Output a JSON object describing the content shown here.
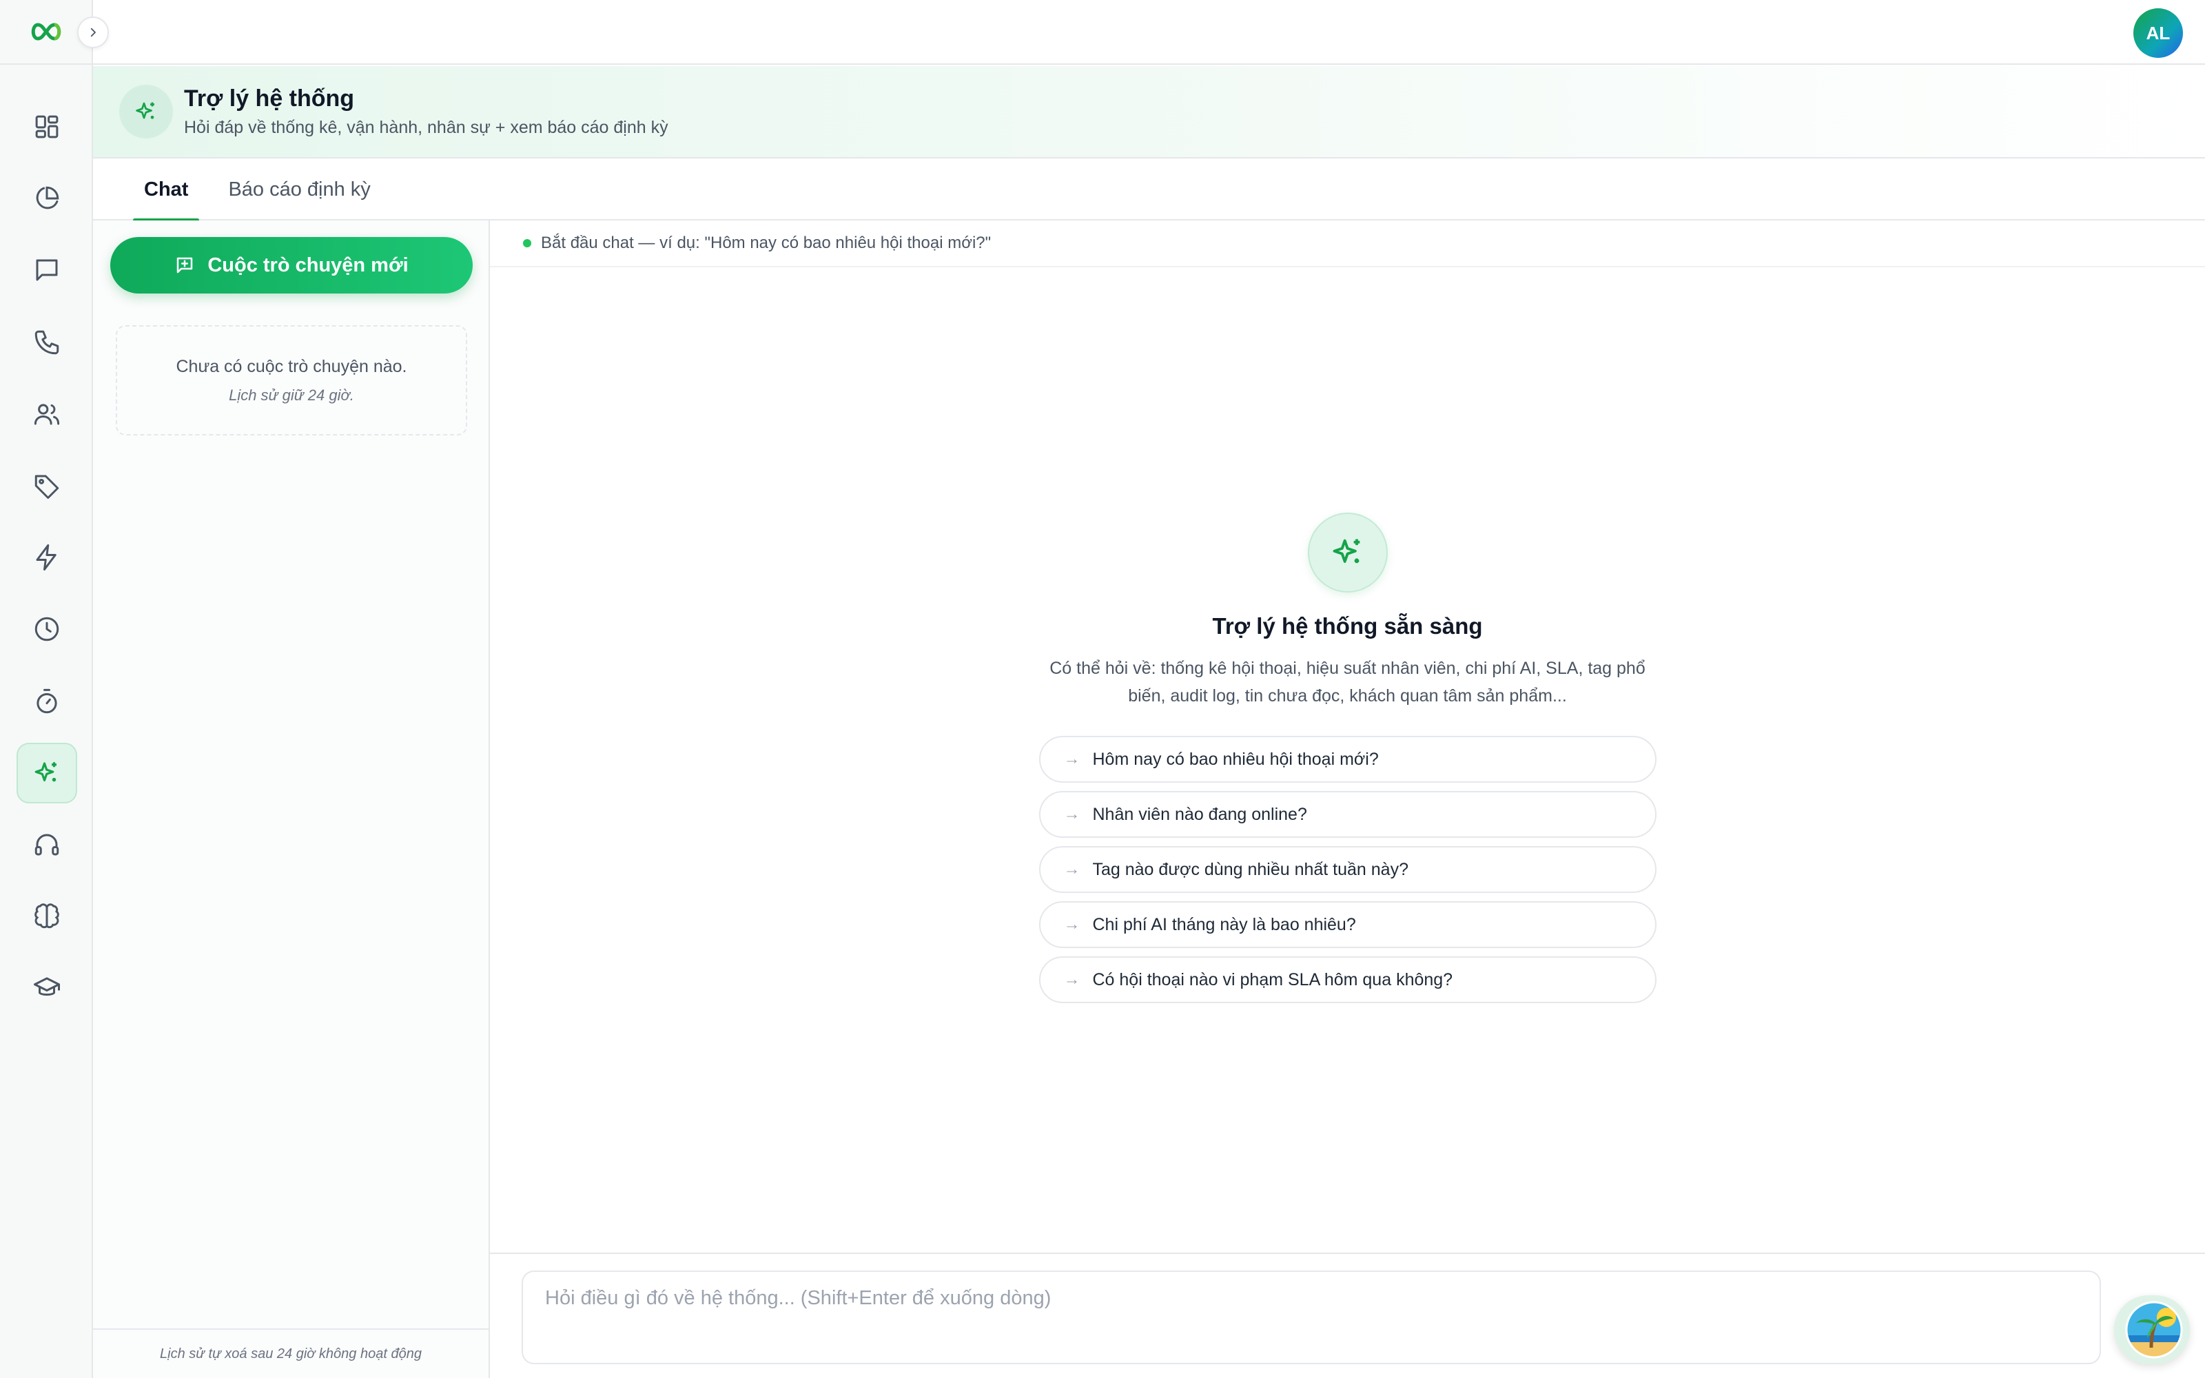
{
  "user": {
    "initials": "AL"
  },
  "header": {
    "title": "Trợ lý hệ thống",
    "subtitle": "Hỏi đáp về thống kê, vận hành, nhân sự + xem báo cáo định kỳ"
  },
  "tabs": [
    {
      "label": "Chat",
      "active": true
    },
    {
      "label": "Báo cáo định kỳ",
      "active": false
    }
  ],
  "sidebar": {
    "new_chat_label": "Cuộc trò chuyện mới",
    "empty_title": "Chưa có cuộc trò chuyện nào.",
    "empty_note": "Lịch sử giữ 24 giờ.",
    "footer": "Lịch sử tự xoá sau 24 giờ không hoạt động"
  },
  "chat": {
    "status": "Bắt đầu chat — ví dụ: \"Hôm nay có bao nhiêu hội thoại mới?\"",
    "welcome_title": "Trợ lý hệ thống sẵn sàng",
    "welcome_desc": "Có thể hỏi về: thống kê hội thoại, hiệu suất nhân viên, chi phí AI, SLA, tag phổ biến, audit log, tin chưa đọc, khách quan tâm sản phẩm...",
    "suggestions": [
      "Hôm nay có bao nhiêu hội thoại mới?",
      "Nhân viên nào đang online?",
      "Tag nào được dùng nhiều nhất tuần này?",
      "Chi phí AI tháng này là bao nhiêu?",
      "Có hội thoại nào vi phạm SLA hôm qua không?"
    ],
    "suggestion_arrow": "→",
    "input_placeholder": "Hỏi điều gì đó về hệ thống... (Shift+Enter để xuống dòng)"
  },
  "rail_icons": [
    "dashboard-icon",
    "pie-chart-icon",
    "chat-bubble-icon",
    "phone-icon",
    "users-icon",
    "tag-icon",
    "lightning-icon",
    "clock-icon",
    "timer-icon",
    "sparkles-icon",
    "headset-icon",
    "brain-icon",
    "graduation-cap-icon"
  ],
  "colors": {
    "accent": "#16a34a",
    "accent_light": "#dff5ea",
    "border": "#e5e7eb"
  }
}
